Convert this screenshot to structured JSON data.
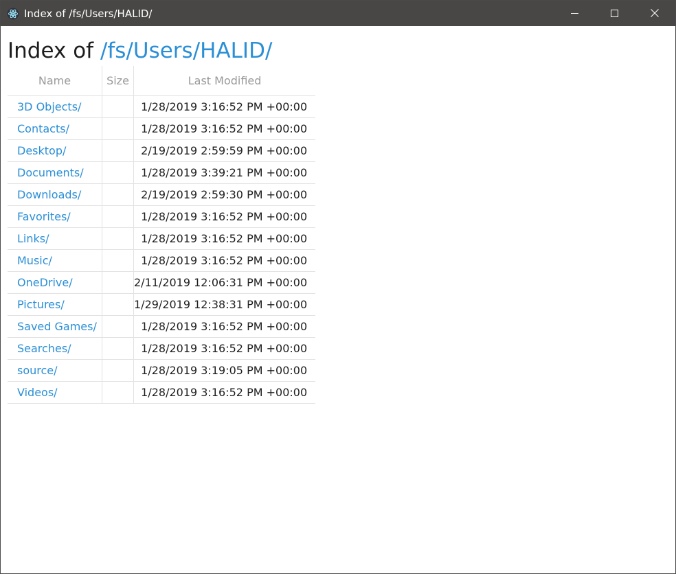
{
  "window": {
    "title": "Index of /fs/Users/HALID/"
  },
  "page": {
    "heading_prefix": "Index of",
    "heading_path": "/fs/Users/HALID/"
  },
  "table": {
    "headers": {
      "name": "Name",
      "size": "Size",
      "modified": "Last Modified"
    },
    "rows": [
      {
        "name": "3D Objects/",
        "size": "",
        "modified": "1/28/2019 3:16:52 PM +00:00"
      },
      {
        "name": "Contacts/",
        "size": "",
        "modified": "1/28/2019 3:16:52 PM +00:00"
      },
      {
        "name": "Desktop/",
        "size": "",
        "modified": "2/19/2019 2:59:59 PM +00:00"
      },
      {
        "name": "Documents/",
        "size": "",
        "modified": "1/28/2019 3:39:21 PM +00:00"
      },
      {
        "name": "Downloads/",
        "size": "",
        "modified": "2/19/2019 2:59:30 PM +00:00"
      },
      {
        "name": "Favorites/",
        "size": "",
        "modified": "1/28/2019 3:16:52 PM +00:00"
      },
      {
        "name": "Links/",
        "size": "",
        "modified": "1/28/2019 3:16:52 PM +00:00"
      },
      {
        "name": "Music/",
        "size": "",
        "modified": "1/28/2019 3:16:52 PM +00:00"
      },
      {
        "name": "OneDrive/",
        "size": "",
        "modified": "2/11/2019 12:06:31 PM +00:00"
      },
      {
        "name": "Pictures/",
        "size": "",
        "modified": "1/29/2019 12:38:31 PM +00:00"
      },
      {
        "name": "Saved Games/",
        "size": "",
        "modified": "1/28/2019 3:16:52 PM +00:00"
      },
      {
        "name": "Searches/",
        "size": "",
        "modified": "1/28/2019 3:16:52 PM +00:00"
      },
      {
        "name": "source/",
        "size": "",
        "modified": "1/28/2019 3:19:05 PM +00:00"
      },
      {
        "name": "Videos/",
        "size": "",
        "modified": "1/28/2019 3:16:52 PM +00:00"
      }
    ]
  },
  "icons": {
    "app": "electron-app-icon",
    "minimize": "minimize-icon",
    "maximize": "maximize-icon",
    "close": "close-icon"
  },
  "colors": {
    "titlebar": "#484745",
    "link": "#2b8fd6",
    "text": "#1e1e1e",
    "header_text": "#9a9a9a",
    "border": "#e2e2e2"
  }
}
